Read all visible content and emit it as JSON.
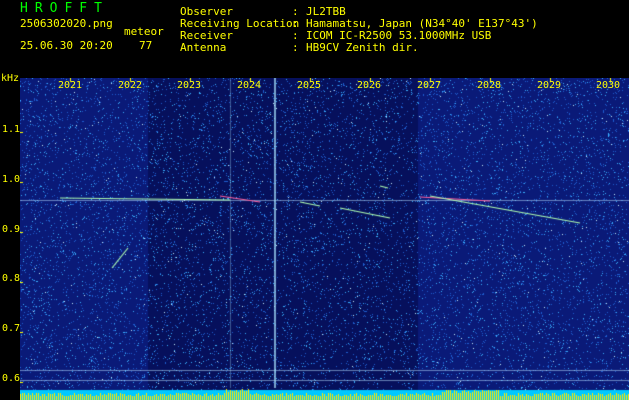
{
  "header": {
    "brand": "HROFFT",
    "filename": "2506302020.png",
    "meteor_label": "meteor",
    "timestamp": "25.06.30 20:20",
    "meteor_count": "77",
    "fields": [
      {
        "label": "Observer",
        "sep": ":",
        "value": "JL2TBB"
      },
      {
        "label": "Receiving Location",
        "sep": ":",
        "value": "Hamamatsu, Japan (N34°40' E137°43')"
      },
      {
        "label": "Receiver",
        "sep": ":",
        "value": "ICOM IC-R2500 53.1000MHz USB"
      },
      {
        "label": "Antenna",
        "sep": ":",
        "value": "HB9CV Zenith dir."
      }
    ]
  },
  "plot": {
    "freq_unit": "kHz",
    "time_ticks": [
      "2021",
      "2022",
      "2023",
      "2024",
      "2025",
      "2026",
      "2027",
      "2028",
      "2029",
      "2030"
    ],
    "freq_ticks": [
      "1.1",
      "1.0",
      "0.9",
      "0.8",
      "0.7",
      "0.6"
    ],
    "colors": {
      "background": "#0a1a78",
      "noise": "#3ab0ff",
      "echo": "#b0ffb0",
      "carrier": "#ff60a0",
      "level_bar": "#ffe800",
      "level_base": "#00c8ff"
    }
  }
}
